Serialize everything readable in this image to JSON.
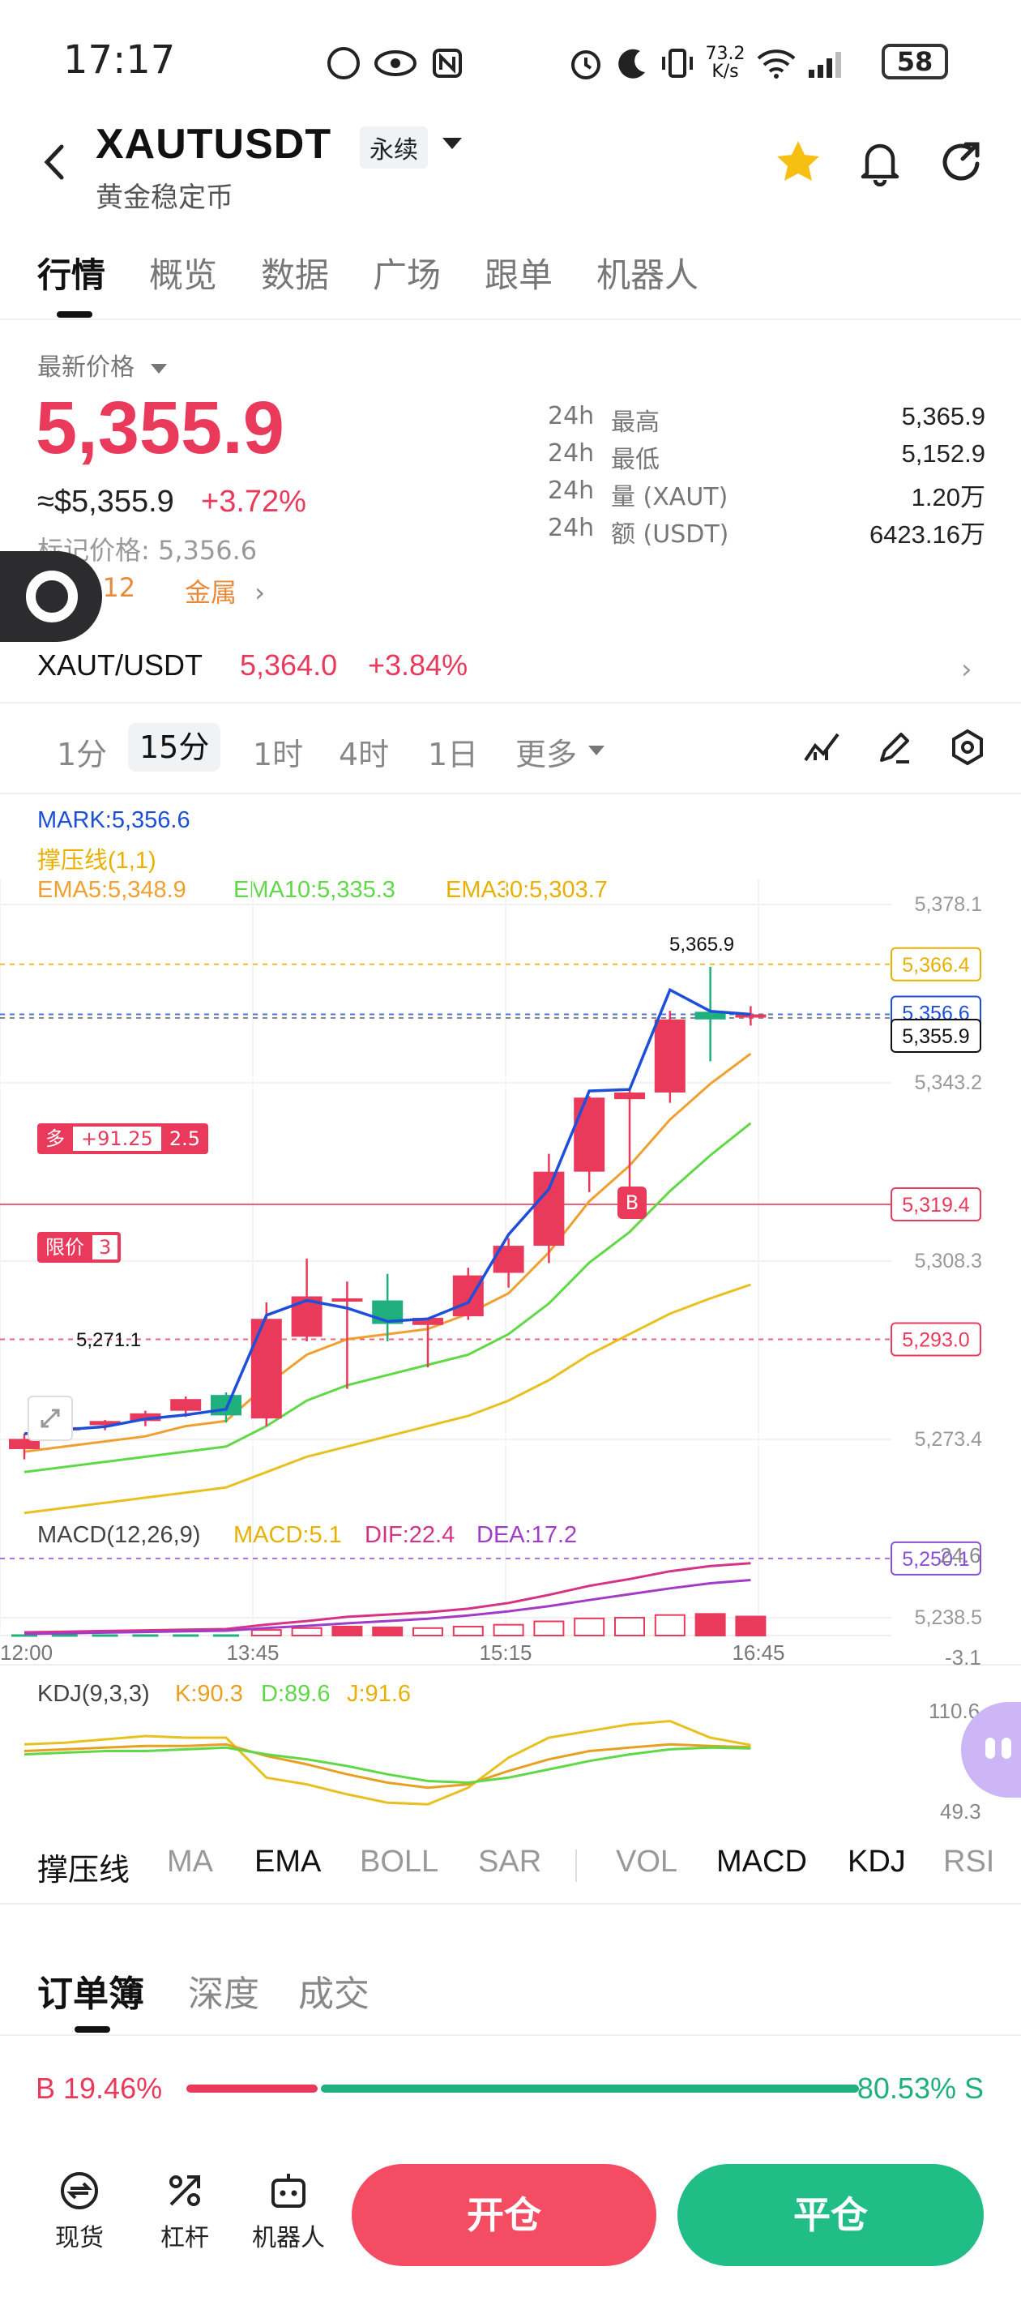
{
  "status": {
    "time": "17:17",
    "net_speed": "73.2\nK/s",
    "battery": "58"
  },
  "header": {
    "symbol": "XAUTUSDT",
    "contract_type": "永续",
    "subtitle": "黄金稳定币"
  },
  "tabs": [
    "行情",
    "概览",
    "数据",
    "广场",
    "跟单",
    "机器人"
  ],
  "ticker": {
    "price_label": "最新价格",
    "last_price": "5,355.9",
    "usd_price": "≈$5,355.9",
    "change_pct": "+3.72%",
    "mark_price": "标记价格: 5,356.6",
    "funding": "0.12",
    "category": "金属",
    "stats": [
      {
        "period": "24h",
        "label": "最高",
        "value": "5,365.9"
      },
      {
        "period": "24h",
        "label": "最低",
        "value": "5,152.9"
      },
      {
        "period": "24h",
        "label": "量 (XAUT)",
        "value": "1.20万"
      },
      {
        "period": "24h",
        "label": "额 (USDT)",
        "value": "6423.16万"
      }
    ]
  },
  "spot": {
    "pair": "XAUT/USDT",
    "price": "5,364.0",
    "change_pct": "+3.84%"
  },
  "intervals": [
    "1分",
    "15分",
    "1时",
    "4时",
    "1日",
    "更多"
  ],
  "active_interval": "15分",
  "chart_legend": {
    "mark": "MARK:5,356.6",
    "support": "撑压线(1,1)",
    "ema5": "EMA5:5,348.9",
    "ema10": "EMA10:5,335.3",
    "ema30": "EMA30:5,303.7",
    "position_side": "多",
    "position_pnl": "+91.25",
    "position_size": "2.5",
    "order_label": "限价",
    "order_qty": "3",
    "buy_marker": "B",
    "high_label": "5,365.9",
    "low_label": "5,271.1",
    "macd": {
      "name": "MACD(12,26,9)",
      "macd": "MACD:5.1",
      "dif": "DIF:22.4",
      "dea": "DEA:17.2",
      "top": "24.6",
      "bottom": "-3.1"
    },
    "kdj": {
      "name": "KDJ(9,3,3)",
      "k": "K:90.3",
      "d": "D:89.6",
      "j": "J:91.6",
      "top": "110.6",
      "bottom": "49.3"
    }
  },
  "colors": {
    "up": "#ea3a5c",
    "down": "#1fb07e",
    "mark": "#1d4fd8",
    "ema5": "#f0a030",
    "ema10": "#60d848",
    "ema30": "#e8c020",
    "accent_orange": "#e88a3c"
  },
  "chart_data": {
    "type": "candlestick",
    "x_ticks": [
      "12:00",
      "13:45",
      "15:15",
      "16:45"
    ],
    "y_ticks": [
      "5,378.1",
      "5,343.2",
      "5,308.3",
      "5,273.4",
      "5,238.5"
    ],
    "ylim": [
      5238.5,
      5378.1
    ],
    "price_tags": [
      {
        "value": 5366.4,
        "label": "5,366.4",
        "color": "#e8b000"
      },
      {
        "value": 5356.6,
        "label": "5,356.6",
        "color": "#1d4fd8"
      },
      {
        "value": 5355.9,
        "label": "5,355.9",
        "color": "#111111"
      },
      {
        "value": 5319.4,
        "label": "5,319.4",
        "color": "#ea3a5c"
      },
      {
        "value": 5293.0,
        "label": "5,293.0",
        "color": "#ea3a5c"
      },
      {
        "value": 5250.1,
        "label": "5,250.1",
        "color": "#8a4fd8"
      }
    ],
    "candles": [
      {
        "o": 5271.5,
        "h": 5274.5,
        "l": 5269.5,
        "c": 5273.5
      },
      {
        "o": 5275.2,
        "h": 5276.2,
        "l": 5274.2,
        "c": 5275.8
      },
      {
        "o": 5276.2,
        "h": 5277.2,
        "l": 5275.2,
        "c": 5277.0
      },
      {
        "o": 5277.0,
        "h": 5279.0,
        "l": 5276.0,
        "c": 5278.5
      },
      {
        "o": 5279.0,
        "h": 5281.8,
        "l": 5277.8,
        "c": 5281.3
      },
      {
        "o": 5282.1,
        "h": 5282.6,
        "l": 5276.7,
        "c": 5278.1
      },
      {
        "o": 5277.5,
        "h": 5300.2,
        "l": 5276.0,
        "c": 5297.0
      },
      {
        "o": 5293.5,
        "h": 5308.8,
        "l": 5292.6,
        "c": 5301.4
      },
      {
        "o": 5301.0,
        "h": 5304.3,
        "l": 5283.3,
        "c": 5301.0
      },
      {
        "o": 5300.6,
        "h": 5305.8,
        "l": 5292.6,
        "c": 5296.0
      },
      {
        "o": 5295.8,
        "h": 5297.2,
        "l": 5287.5,
        "c": 5297.2
      },
      {
        "o": 5297.5,
        "h": 5307.0,
        "l": 5296.8,
        "c": 5305.5
      },
      {
        "o": 5306.0,
        "h": 5312.8,
        "l": 5303.1,
        "c": 5311.3
      },
      {
        "o": 5311.3,
        "h": 5329.3,
        "l": 5307.9,
        "c": 5325.8
      },
      {
        "o": 5325.8,
        "h": 5340.6,
        "l": 5321.8,
        "c": 5340.3
      },
      {
        "o": 5340.0,
        "h": 5341.8,
        "l": 5322.7,
        "c": 5341.3
      },
      {
        "o": 5341.3,
        "h": 5357.3,
        "l": 5339.3,
        "c": 5355.6
      },
      {
        "o": 5357.1,
        "h": 5365.9,
        "l": 5347.4,
        "c": 5355.6
      },
      {
        "o": 5356.0,
        "h": 5358.2,
        "l": 5354.4,
        "c": 5356.6
      }
    ],
    "ema5": [
      5271,
      5272,
      5273,
      5274,
      5276,
      5277,
      5284,
      5290,
      5293,
      5294,
      5295,
      5298,
      5302,
      5310,
      5320,
      5327,
      5336,
      5343,
      5348.9
    ],
    "ema10": [
      5267,
      5268,
      5269,
      5270,
      5271,
      5272,
      5276,
      5281,
      5284,
      5286,
      5288,
      5290,
      5294,
      5300,
      5308,
      5314,
      5322,
      5329,
      5335.3
    ],
    "ema30": [
      5259,
      5260,
      5261,
      5262,
      5263,
      5264,
      5267,
      5270,
      5272,
      5274,
      5276,
      5278,
      5281,
      5285,
      5290,
      5294,
      5298,
      5301,
      5303.7
    ],
    "mark": [
      5274.5,
      5275.3,
      5275.9,
      5277.4,
      5278.2,
      5279.3,
      5297.7,
      5300.6,
      5299.1,
      5296.5,
      5297.0,
      5300.2,
      5313.5,
      5322.4,
      5341.6,
      5341.9,
      5361.4,
      5357.2,
      5356.6
    ],
    "macd_hist": [
      0.8,
      0.6,
      0.5,
      0.4,
      0.3,
      0.2,
      1.5,
      2.0,
      2.4,
      2.2,
      2.0,
      2.4,
      2.9,
      3.8,
      4.6,
      4.8,
      5.5,
      5.8,
      5.1
    ],
    "macd_dif": [
      1,
      1.2,
      1.4,
      1.6,
      1.8,
      2.0,
      3.4,
      4.5,
      5.8,
      6.5,
      7.2,
      8.3,
      10.1,
      12.6,
      15.4,
      17.5,
      19.9,
      21.5,
      22.4
    ],
    "macd_dea": [
      0.5,
      0.7,
      0.9,
      1.1,
      1.3,
      1.5,
      2.3,
      3.0,
      3.8,
      4.5,
      5.2,
      6.2,
      7.5,
      9.1,
      11.0,
      12.8,
      14.6,
      16.2,
      17.2
    ],
    "kdj_k": [
      88,
      89,
      90,
      91,
      91,
      92,
      85,
      80,
      74,
      69,
      66,
      68,
      76,
      83,
      88,
      90,
      92,
      91,
      90.3
    ],
    "kdj_d": [
      86,
      87,
      88,
      88,
      89,
      90,
      86,
      83,
      79,
      74,
      70,
      69,
      72,
      77,
      82,
      86,
      89,
      90,
      89.6
    ],
    "kdj_j": [
      92,
      93,
      95,
      97,
      96,
      96,
      72,
      68,
      62,
      57,
      56,
      66,
      84,
      96,
      100,
      104,
      106,
      96,
      91.6
    ]
  },
  "indicators": [
    "撑压线",
    "MA",
    "EMA",
    "BOLL",
    "SAR",
    "VOL",
    "MACD",
    "KDJ",
    "RSI"
  ],
  "indicators_on": [
    "撑压线",
    "EMA",
    "MACD",
    "KDJ"
  ],
  "order_book": {
    "tabs": [
      "订单簿",
      "深度",
      "成交"
    ],
    "buy_ratio": "B 19.46%",
    "sell_ratio": "80.53% S",
    "buy_fraction": 0.1946
  },
  "bottom_nav": [
    "现货",
    "杠杆",
    "机器人"
  ],
  "actions": {
    "open": "开仓",
    "close": "平仓"
  }
}
